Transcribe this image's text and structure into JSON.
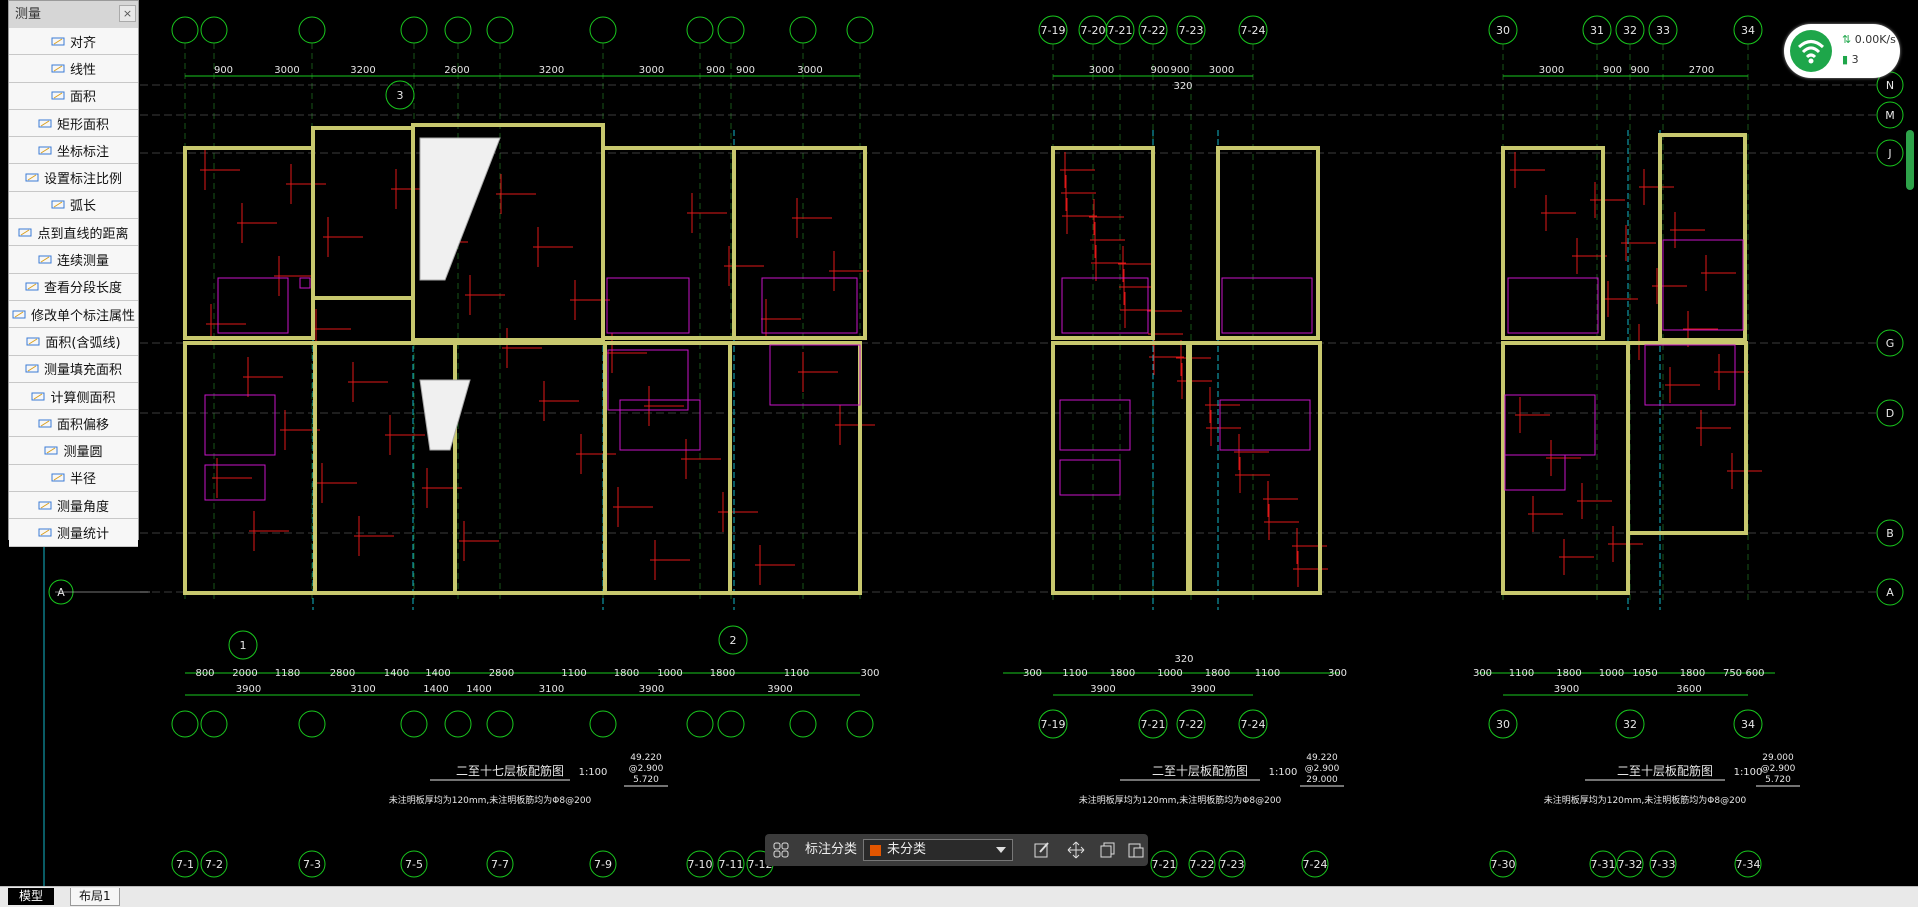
{
  "measure_panel": {
    "title": "测量",
    "close_glyph": "×",
    "tools": [
      {
        "label": "对齐",
        "icon": "align-dimension-icon"
      },
      {
        "label": "线性",
        "icon": "linear-dimension-icon"
      },
      {
        "label": "面积",
        "icon": "area-icon"
      },
      {
        "label": "矩形面积",
        "icon": "rectangle-area-icon"
      },
      {
        "label": "坐标标注",
        "icon": "coordinate-icon"
      },
      {
        "label": "设置标注比例",
        "icon": "scale-icon"
      },
      {
        "label": "弧长",
        "icon": "arc-length-icon"
      },
      {
        "label": "点到直线的距离",
        "icon": "point-line-distance-icon"
      },
      {
        "label": "连续测量",
        "icon": "continuous-measure-icon"
      },
      {
        "label": "查看分段长度",
        "icon": "segment-length-icon"
      },
      {
        "label": "修改单个标注属性",
        "icon": "edit-annotation-icon"
      },
      {
        "label": "面积(含弧线)",
        "icon": "arc-area-icon"
      },
      {
        "label": "测量填充面积",
        "icon": "hatch-area-icon"
      },
      {
        "label": "计算侧面积",
        "icon": "side-area-icon"
      },
      {
        "label": "面积偏移",
        "icon": "area-offset-icon"
      },
      {
        "label": "测量圆",
        "icon": "circle-measure-icon"
      },
      {
        "label": "半径",
        "icon": "radius-icon"
      },
      {
        "label": "测量角度",
        "icon": "angle-icon"
      },
      {
        "label": "测量统计",
        "icon": "statistics-icon"
      }
    ]
  },
  "network_widget": {
    "speed": "0.00K/s",
    "count": "3"
  },
  "annotation_bar": {
    "label": "标注分类",
    "selected": "未分类",
    "swatch_color": "#e25500"
  },
  "layout_tabs": [
    {
      "label": "模型"
    },
    {
      "label": "布局1"
    }
  ],
  "drawing": {
    "top_dims_left": [
      "900",
      "3000",
      "3200",
      "2600",
      "3200",
      "3000",
      "900",
      "900",
      "3000"
    ],
    "top_dims_mid": [
      "3000",
      "900",
      "900",
      "3000",
      "320"
    ],
    "top_dims_right": [
      "3000",
      "900",
      "900",
      "2700"
    ],
    "top_grid_left": [
      "",
      "",
      "",
      "",
      "",
      "",
      "",
      "",
      "",
      ""
    ],
    "top_grid_mid": [
      "7-19",
      "7-20",
      "7-21",
      "7-22",
      "7-23",
      "7-24"
    ],
    "top_grid_right": [
      "30",
      "31",
      "32",
      "33",
      "34"
    ],
    "right_axes": [
      "N",
      "M",
      "J",
      "G",
      "D",
      "B",
      "A"
    ],
    "left_axis": "A",
    "bottom_dims_1": [
      "800",
      "2000",
      "1180",
      "2800",
      "1400",
      "1400",
      "2800",
      "1100",
      "1800",
      "1000",
      "1800",
      "1100",
      "300"
    ],
    "bottom_dims_1b": [
      "300",
      "1100",
      "1800",
      "1000",
      "1800",
      "1100",
      "300"
    ],
    "bottom_dims_1c": [
      "300",
      "1100",
      "1800",
      "1000",
      "1050",
      "1800",
      "750",
      "600"
    ],
    "bottom_dims_2a": [
      "3900",
      "3100",
      "1400",
      "1400",
      "3100",
      "3900",
      "3900"
    ],
    "bottom_dims_2b": [
      "3900",
      "3900"
    ],
    "bottom_dims_2c": [
      "3900",
      "3600"
    ],
    "bottom_grid_mid": [
      "7-19",
      "7-21",
      "7-22",
      "7-24"
    ],
    "bottom_grid_right": [
      "30",
      "32",
      "34"
    ],
    "titles": [
      {
        "title": "二至十七层板配筋图",
        "scale": "1:100",
        "note": "未注明板厚均为120mm,未注明板筋均为Φ8@200",
        "levels": [
          "49.220",
          "@2.900",
          "5.720"
        ]
      },
      {
        "title": "二至十层板配筋图",
        "scale": "1:100",
        "note": "未注明板厚均为120mm,未注明板筋均为Φ8@200",
        "levels": [
          "49.220",
          "@2.900",
          "29.000"
        ]
      },
      {
        "title": "二至十层板配筋图",
        "scale": "1:100",
        "note": "未注明板厚均为120mm,未注明板筋均为Φ8@200",
        "levels": [
          "29.000",
          "@2.900",
          "5.720"
        ]
      }
    ],
    "section_marks": [
      "3",
      "1",
      "2"
    ],
    "bottom_row_grid": [
      "7-1",
      "7-2",
      "7-3",
      "7-5",
      "7-7",
      "7-9",
      "7-10",
      "7-11",
      "7-12",
      "7-21",
      "7-22",
      "7-23",
      "7-24",
      "7-30",
      "7-31",
      "7-32",
      "7-33",
      "7-34"
    ],
    "mid_label": "320"
  }
}
